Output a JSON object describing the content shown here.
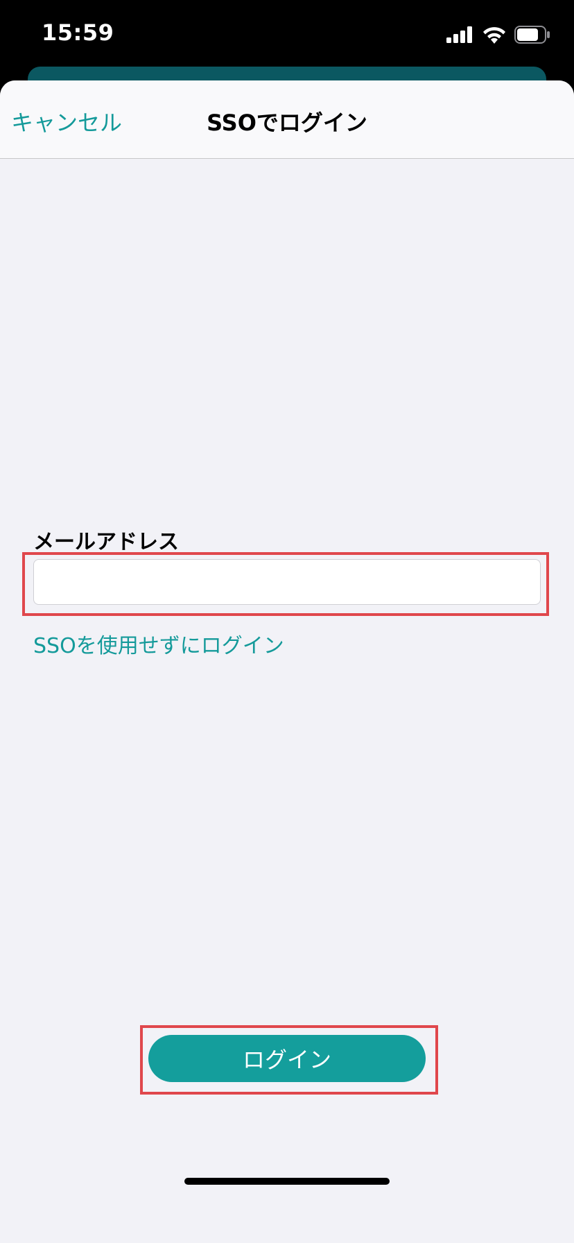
{
  "status_bar": {
    "time": "15:59",
    "icons": [
      "signal-icon",
      "wifi-icon",
      "battery-icon"
    ]
  },
  "nav": {
    "cancel_label": "キャンセル",
    "title": "SSOでログイン"
  },
  "form": {
    "email_label": "メールアドレス",
    "email_value": "",
    "email_placeholder": "",
    "no_sso_link": "SSOを使用せずにログイン"
  },
  "login_button_label": "ログイン",
  "colors": {
    "accent": "#149a9a",
    "button": "#149e9c",
    "highlight": "#e0474c",
    "background": "#f2f2f7"
  }
}
